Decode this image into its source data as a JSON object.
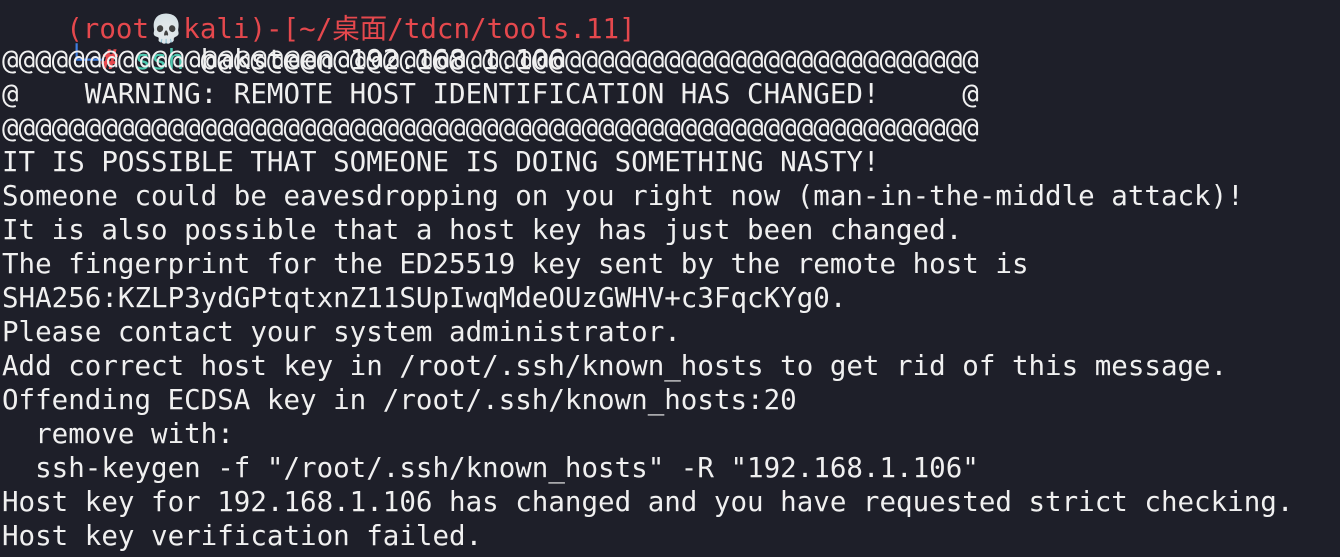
{
  "prompt": {
    "header_text": "(root💀kali)-[~/桌面/tdcn/tools.11]",
    "tree_corner": "└─",
    "symbol": "#",
    "command": "ssh",
    "args": "baksteen@192.168.1.106"
  },
  "output": [
    "@@@@@@@@@@@@@@@@@@@@@@@@@@@@@@@@@@@@@@@@@@@@@@@@@@@@@@@@@@@",
    "@    WARNING: REMOTE HOST IDENTIFICATION HAS CHANGED!     @",
    "@@@@@@@@@@@@@@@@@@@@@@@@@@@@@@@@@@@@@@@@@@@@@@@@@@@@@@@@@@@",
    "IT IS POSSIBLE THAT SOMEONE IS DOING SOMETHING NASTY!",
    "Someone could be eavesdropping on you right now (man-in-the-middle attack)!",
    "It is also possible that a host key has just been changed.",
    "The fingerprint for the ED25519 key sent by the remote host is",
    "SHA256:KZLP3ydGPtqtxnZ11SUpIwqMdeOUzGWHV+c3FqcKYg0.",
    "Please contact your system administrator.",
    "Add correct host key in /root/.ssh/known_hosts to get rid of this message.",
    "Offending ECDSA key in /root/.ssh/known_hosts:20",
    "  remove with:",
    "  ssh-keygen -f \"/root/.ssh/known_hosts\" -R \"192.168.1.106\"",
    "Host key for 192.168.1.106 has changed and you have requested strict checking.",
    "Host key verification failed."
  ]
}
